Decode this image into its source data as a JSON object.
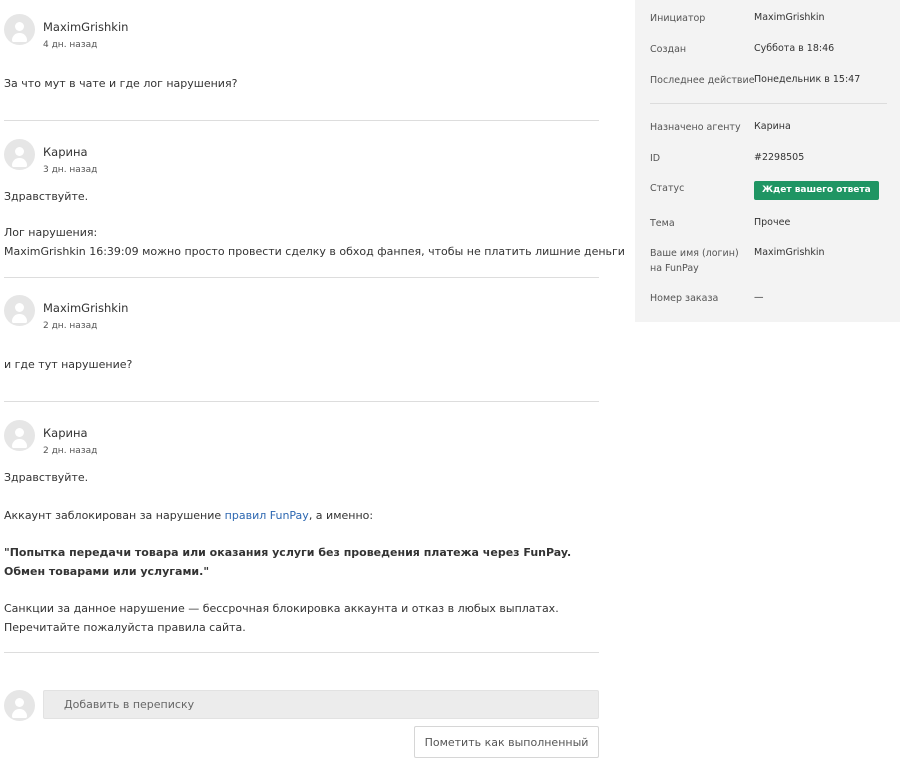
{
  "messages": [
    {
      "author": "MaximGrishkin",
      "time": "4 дн. назад",
      "lines": [
        "За что мут в чате и где лог нарушения?"
      ]
    },
    {
      "author": "Карина",
      "time": "3 дн. назад",
      "lines": [
        "Здравствуйте.",
        "Лог нарушения:",
        "MaximGrishkin 16:39:09 можно просто провести сделку в обход фанпея, чтобы не платить лишние деньги"
      ]
    },
    {
      "author": "MaximGrishkin",
      "time": "2 дн. назад",
      "lines": [
        "и где тут нарушение?"
      ]
    },
    {
      "author": "Карина",
      "time": "2 дн. назад",
      "greeting": "Здравствуйте.",
      "blocked_before": "Аккаунт заблокирован за нарушение ",
      "rules_link": "правил FunPay",
      "blocked_after": ", а именно:",
      "quote": "\"Попытка передачи товара или оказания услуги без проведения платежа через FunPay. Обмен товарами или услугами.\"",
      "sanctions": "Санкции за данное нарушение — бессрочная блокировка аккаунта и отказ в любых выплатах.",
      "reread": "Перечитайте пожалуйста правила сайта."
    }
  ],
  "compose": {
    "placeholder": "Добавить в переписку",
    "done_label": "Пометить как выполненный"
  },
  "sidebar": {
    "initiator_label": "Инициатор",
    "initiator_value": "MaximGrishkin",
    "created_label": "Создан",
    "created_value": "Суббота в 18:46",
    "last_action_label": "Последнее действие",
    "last_action_value": "Понедельник в 15:47",
    "agent_label": "Назначено агенту",
    "agent_value": "Карина",
    "id_label": "ID",
    "id_value": "#2298505",
    "status_label": "Статус",
    "status_value": "Ждет вашего ответа",
    "status_color": "#1f9563",
    "topic_label": "Тема",
    "topic_value": "Прочее",
    "username_label": "Ваше имя (логин) на FunPay",
    "username_value": "MaximGrishkin",
    "order_label": "Номер заказа",
    "order_value": "—"
  },
  "icons": {
    "avatar": "user-avatar-icon"
  }
}
